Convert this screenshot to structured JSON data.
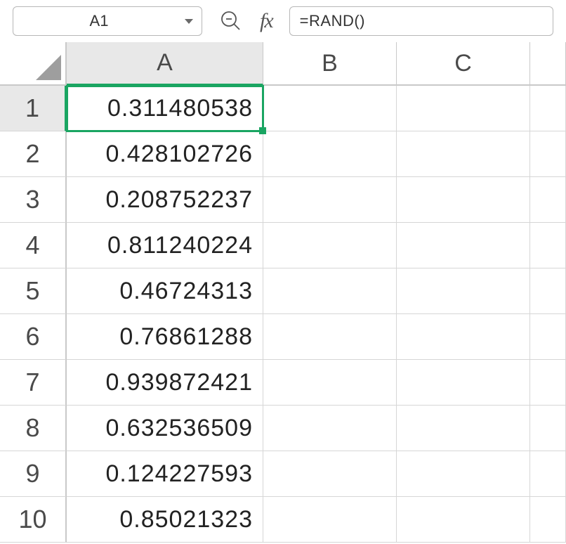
{
  "formula_bar": {
    "name_box_value": "A1",
    "formula_value": "=RAND()"
  },
  "columns": [
    "A",
    "B",
    "C"
  ],
  "selected_column": "A",
  "selected_row": 1,
  "rows": [
    {
      "n": "1",
      "A": "0.311480538",
      "B": "",
      "C": ""
    },
    {
      "n": "2",
      "A": "0.428102726",
      "B": "",
      "C": ""
    },
    {
      "n": "3",
      "A": "0.208752237",
      "B": "",
      "C": ""
    },
    {
      "n": "4",
      "A": "0.811240224",
      "B": "",
      "C": ""
    },
    {
      "n": "5",
      "A": "0.46724313",
      "B": "",
      "C": ""
    },
    {
      "n": "6",
      "A": "0.76861288",
      "B": "",
      "C": ""
    },
    {
      "n": "7",
      "A": "0.939872421",
      "B": "",
      "C": ""
    },
    {
      "n": "8",
      "A": "0.632536509",
      "B": "",
      "C": ""
    },
    {
      "n": "9",
      "A": "0.124227593",
      "B": "",
      "C": ""
    },
    {
      "n": "10",
      "A": "0.85021323",
      "B": "",
      "C": ""
    }
  ]
}
